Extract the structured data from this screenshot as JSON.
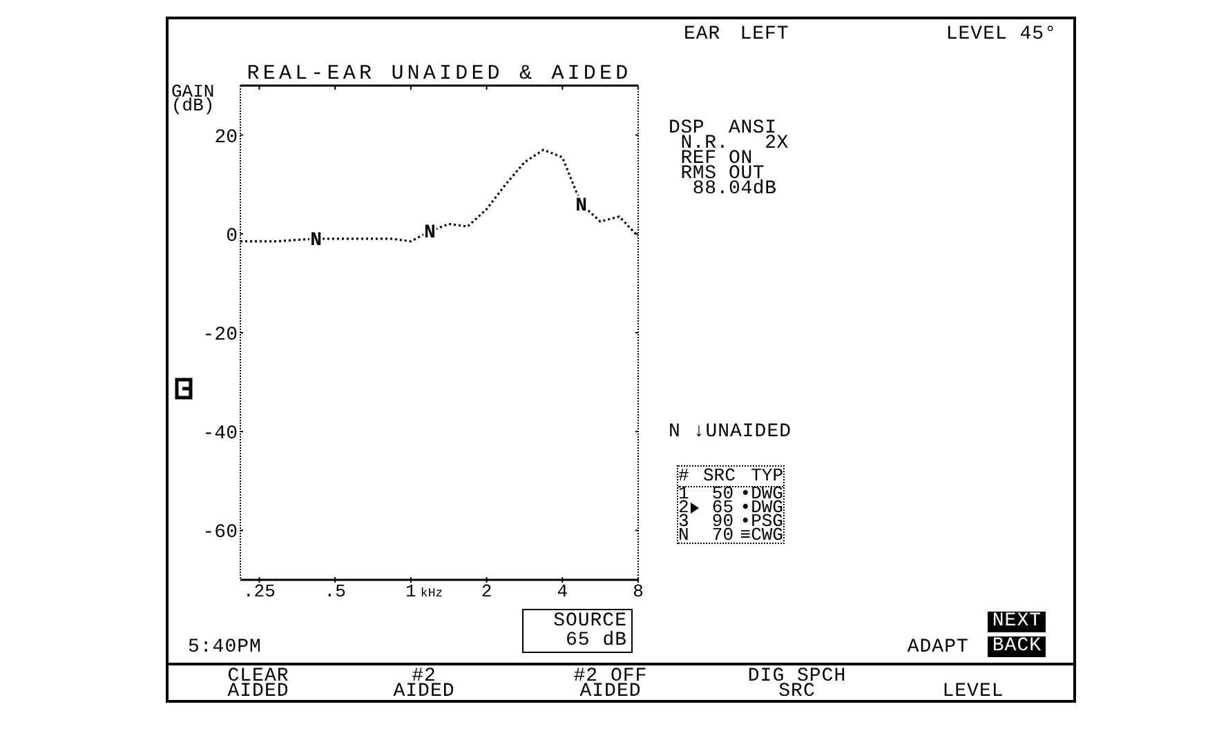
{
  "chart": {
    "chart_data": {
      "type": "line",
      "title": "REAL-EAR UNAIDED & AIDED",
      "xlabel": "kHz",
      "ylabel": "GAIN (dB)",
      "ylim": [
        -70,
        30
      ],
      "yticks": [
        {
          "value": -60,
          "label": "-60"
        },
        {
          "value": -40,
          "label": "-40"
        },
        {
          "value": -20,
          "label": "-20"
        },
        {
          "value": 0,
          "label": "0"
        },
        {
          "value": 20,
          "label": "20"
        }
      ],
      "categories": [
        null,
        ".25",
        null,
        null,
        null,
        ".5",
        null,
        null,
        null,
        "1",
        null,
        null,
        null,
        "2",
        null,
        null,
        null,
        "4",
        null,
        null,
        null,
        "8"
      ],
      "series": [
        {
          "name": "N ↓UNAIDED",
          "color": "#000000",
          "line_style": "dotted",
          "values": [
            -1.5,
            -1.5,
            -1.5,
            -1.2,
            -1,
            -1,
            -1,
            -1,
            -1,
            -1.5,
            0.5,
            2,
            1.5,
            5,
            10,
            14.5,
            17,
            15.5,
            6,
            2.5,
            3.5,
            -0.5
          ]
        }
      ],
      "annotations": [
        "N",
        "N",
        "N"
      ]
    }
  },
  "header": {
    "ear_label": "EAR",
    "ear_value": "LEFT",
    "level": "LEVEL 45°"
  },
  "settings": [
    "DSP  ANSI",
    " N.R.   2X",
    " REF ON",
    " RMS OUT",
    "  88.04dB"
  ],
  "source_table": {
    "columns": [
      "#",
      "SRC",
      "TYP"
    ],
    "rows": [
      {
        "num": "1",
        "src": "50",
        "typ": "•DWG",
        "selected": false
      },
      {
        "num": "2",
        "src": "65",
        "typ": "•DWG",
        "selected": true
      },
      {
        "num": "3",
        "src": "90",
        "typ": "•PSG",
        "selected": false
      },
      {
        "num": "N",
        "src": "70",
        "typ": "≡CWG",
        "selected": false
      }
    ]
  },
  "time": "5:40PM",
  "source": [
    "SOURCE",
    "65 dB"
  ],
  "adapt": "ADAPT",
  "nav_buttons": [
    "NEXT",
    "BACK"
  ],
  "softkeys": [
    [
      "CLEAR",
      "AIDED"
    ],
    [
      "#2",
      "AIDED"
    ],
    [
      "#2 OFF",
      "AIDED"
    ],
    [
      "DIG SPCH",
      "SRC"
    ],
    [
      "LEVEL"
    ]
  ]
}
